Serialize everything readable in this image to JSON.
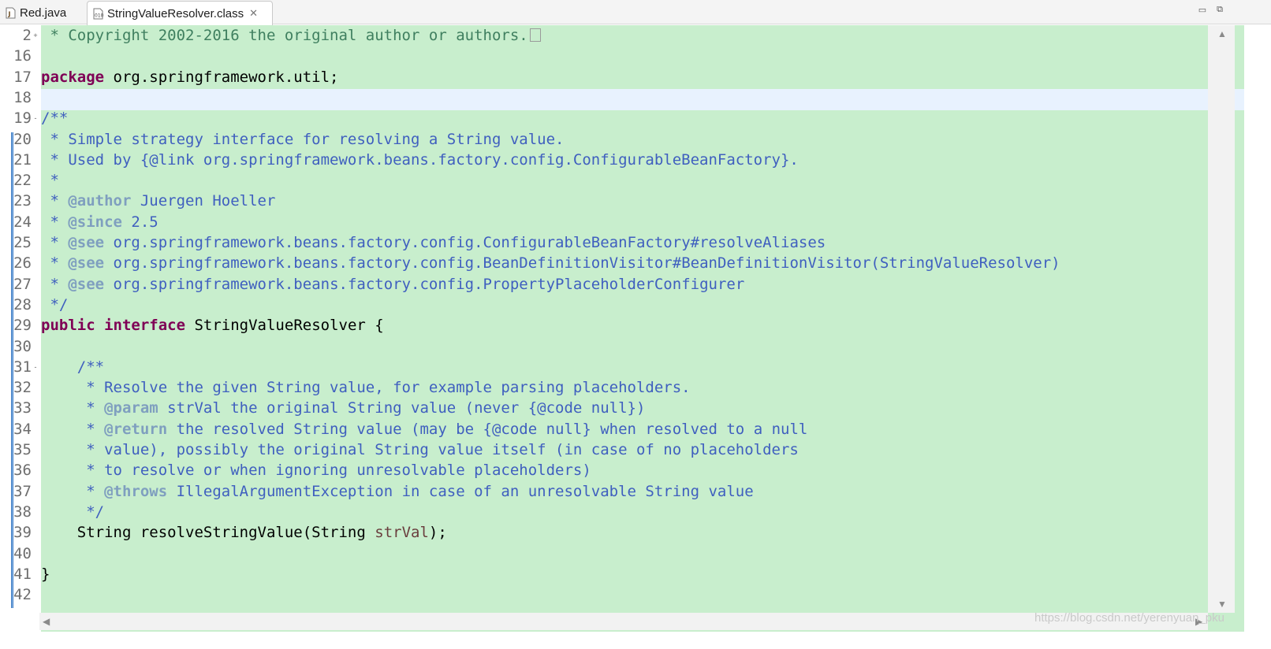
{
  "tabs": [
    {
      "label": "Red.java",
      "icon": "java-file-icon",
      "active": false
    },
    {
      "label": "StringValueResolver.class",
      "icon": "class-file-icon",
      "active": true,
      "close": "✕"
    }
  ],
  "window_controls": {
    "minimize": "▭",
    "maximize": "⧉"
  },
  "editor": {
    "background_color": "#c8eecd",
    "current_line_color": "#e8f2fe",
    "lines": [
      {
        "n": "2",
        "fold": "+",
        "segments": [
          {
            "t": " * Copyright 2002-2016 the original author or authors.",
            "c": "cm"
          }
        ],
        "folded_box": true
      },
      {
        "n": "16",
        "segments": []
      },
      {
        "n": "17",
        "segments": [
          {
            "t": "package",
            "c": "kw"
          },
          {
            "t": " org.springframework.util;",
            "c": ""
          }
        ]
      },
      {
        "n": "18",
        "segments": []
      },
      {
        "n": "19",
        "fold": "-",
        "segments": [
          {
            "t": "/**",
            "c": "jd"
          }
        ]
      },
      {
        "n": "20",
        "segments": [
          {
            "t": " * Simple strategy interface for resolving a String value.",
            "c": "jd"
          }
        ]
      },
      {
        "n": "21",
        "segments": [
          {
            "t": " * Used by {@link org.springframework.beans.factory.config.ConfigurableBeanFactory}.",
            "c": "jd"
          }
        ]
      },
      {
        "n": "22",
        "segments": [
          {
            "t": " *",
            "c": "jd"
          }
        ]
      },
      {
        "n": "23",
        "segments": [
          {
            "t": " * ",
            "c": "jd"
          },
          {
            "t": "@author",
            "c": "jdtag"
          },
          {
            "t": " Juergen Hoeller",
            "c": "jd"
          }
        ]
      },
      {
        "n": "24",
        "segments": [
          {
            "t": " * ",
            "c": "jd"
          },
          {
            "t": "@since",
            "c": "jdtag"
          },
          {
            "t": " 2.5",
            "c": "jd"
          }
        ]
      },
      {
        "n": "25",
        "segments": [
          {
            "t": " * ",
            "c": "jd"
          },
          {
            "t": "@see",
            "c": "jdtag"
          },
          {
            "t": " org.springframework.beans.factory.config.ConfigurableBeanFactory#resolveAliases",
            "c": "jd"
          }
        ]
      },
      {
        "n": "26",
        "segments": [
          {
            "t": " * ",
            "c": "jd"
          },
          {
            "t": "@see",
            "c": "jdtag"
          },
          {
            "t": " org.springframework.beans.factory.config.BeanDefinitionVisitor#BeanDefinitionVisitor(StringValueResolver)",
            "c": "jd"
          }
        ]
      },
      {
        "n": "27",
        "segments": [
          {
            "t": " * ",
            "c": "jd"
          },
          {
            "t": "@see",
            "c": "jdtag"
          },
          {
            "t": " org.springframework.beans.factory.config.PropertyPlaceholderConfigurer",
            "c": "jd"
          }
        ]
      },
      {
        "n": "28",
        "segments": [
          {
            "t": " */",
            "c": "jd"
          }
        ]
      },
      {
        "n": "29",
        "segments": [
          {
            "t": "public",
            "c": "kw"
          },
          {
            "t": " ",
            "c": ""
          },
          {
            "t": "interface",
            "c": "kw"
          },
          {
            "t": " StringValueResolver {",
            "c": ""
          }
        ]
      },
      {
        "n": "30",
        "segments": []
      },
      {
        "n": "31",
        "fold": "-",
        "segments": [
          {
            "t": "    /**",
            "c": "jd"
          }
        ]
      },
      {
        "n": "32",
        "segments": [
          {
            "t": "     * Resolve the given String value, for example parsing placeholders.",
            "c": "jd"
          }
        ]
      },
      {
        "n": "33",
        "segments": [
          {
            "t": "     * ",
            "c": "jd"
          },
          {
            "t": "@param",
            "c": "jdtag"
          },
          {
            "t": " strVal the original String value (never {@code null})",
            "c": "jd"
          }
        ]
      },
      {
        "n": "34",
        "segments": [
          {
            "t": "     * ",
            "c": "jd"
          },
          {
            "t": "@return",
            "c": "jdtag"
          },
          {
            "t": " the resolved String value (may be {@code null} when resolved to a null",
            "c": "jd"
          }
        ]
      },
      {
        "n": "35",
        "segments": [
          {
            "t": "     * value), possibly the original String value itself (in case of no placeholders",
            "c": "jd"
          }
        ]
      },
      {
        "n": "36",
        "segments": [
          {
            "t": "     * to resolve or when ignoring unresolvable placeholders)",
            "c": "jd"
          }
        ]
      },
      {
        "n": "37",
        "segments": [
          {
            "t": "     * ",
            "c": "jd"
          },
          {
            "t": "@throws",
            "c": "jdtag"
          },
          {
            "t": " IllegalArgumentException in case of an unresolvable String value",
            "c": "jd"
          }
        ]
      },
      {
        "n": "38",
        "segments": [
          {
            "t": "     */",
            "c": "jd"
          }
        ]
      },
      {
        "n": "39",
        "segments": [
          {
            "t": "    String resolveStringValue(String ",
            "c": ""
          },
          {
            "t": "strVal",
            "c": "param"
          },
          {
            "t": ");",
            "c": ""
          }
        ]
      },
      {
        "n": "40",
        "segments": []
      },
      {
        "n": "41",
        "segments": [
          {
            "t": "}",
            "c": ""
          }
        ]
      },
      {
        "n": "42",
        "segments": []
      }
    ]
  },
  "scrollbars": {
    "up": "▲",
    "down": "▼",
    "left": "◀",
    "right": "▶"
  },
  "watermark": "https://blog.csdn.net/yerenyuan_pku"
}
